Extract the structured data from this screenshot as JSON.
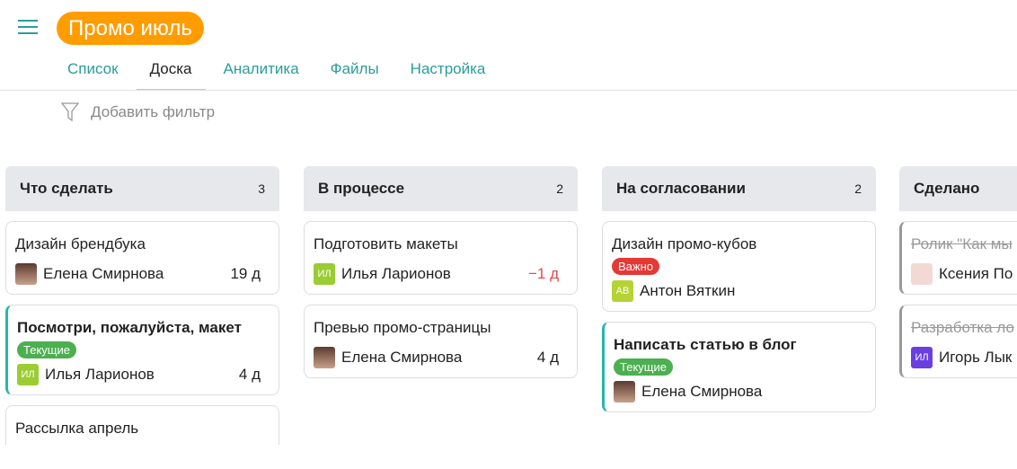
{
  "header": {
    "title": "Промо июль",
    "menu_icon": "hamburger-icon"
  },
  "tabs": [
    {
      "label": "Список"
    },
    {
      "label": "Доска",
      "active": true
    },
    {
      "label": "Аналитика"
    },
    {
      "label": "Файлы"
    },
    {
      "label": "Настройка"
    }
  ],
  "filter": {
    "label": "Добавить фильтр",
    "icon": "filter-icon"
  },
  "colors": {
    "accent": "#2a9d9a",
    "title_bg": "#ff9c00",
    "badge_current": "#4caf50",
    "badge_important": "#e53935"
  },
  "columns": [
    {
      "title": "Что сделать",
      "count": "3",
      "cards": [
        {
          "title": "Дизайн брендбука",
          "assignee": "Елена Смирнова",
          "days": "19 д"
        },
        {
          "title": "Посмотри, пожалуйста, макет",
          "badge": "Текущие",
          "initials": "ИЛ",
          "assignee": "Илья Ларионов",
          "days": "4 д"
        },
        {
          "title": "Рассылка апрель"
        }
      ]
    },
    {
      "title": "В процессе",
      "count": "2",
      "cards": [
        {
          "title": "Подготовить макеты",
          "initials": "ИЛ",
          "assignee": "Илья Ларионов",
          "days": "−1 д"
        },
        {
          "title": "Превью промо-страницы",
          "assignee": "Елена Смирнова",
          "days": "4 д"
        }
      ]
    },
    {
      "title": "На согласовании",
      "count": "2",
      "cards": [
        {
          "title": "Дизайн промо-кубов",
          "badge": "Важно",
          "initials": "АВ",
          "assignee": "Антон Вяткин"
        },
        {
          "title": "Написать статью в блог",
          "badge": "Текущие",
          "assignee": "Елена Смирнова"
        }
      ]
    },
    {
      "title": "Сделано",
      "cards": [
        {
          "title": "Ролик \"Как мы",
          "assignee": "Ксения По"
        },
        {
          "title": "Разработка ло",
          "initials": "ИЛ",
          "assignee": "Игорь Лык"
        }
      ]
    }
  ]
}
